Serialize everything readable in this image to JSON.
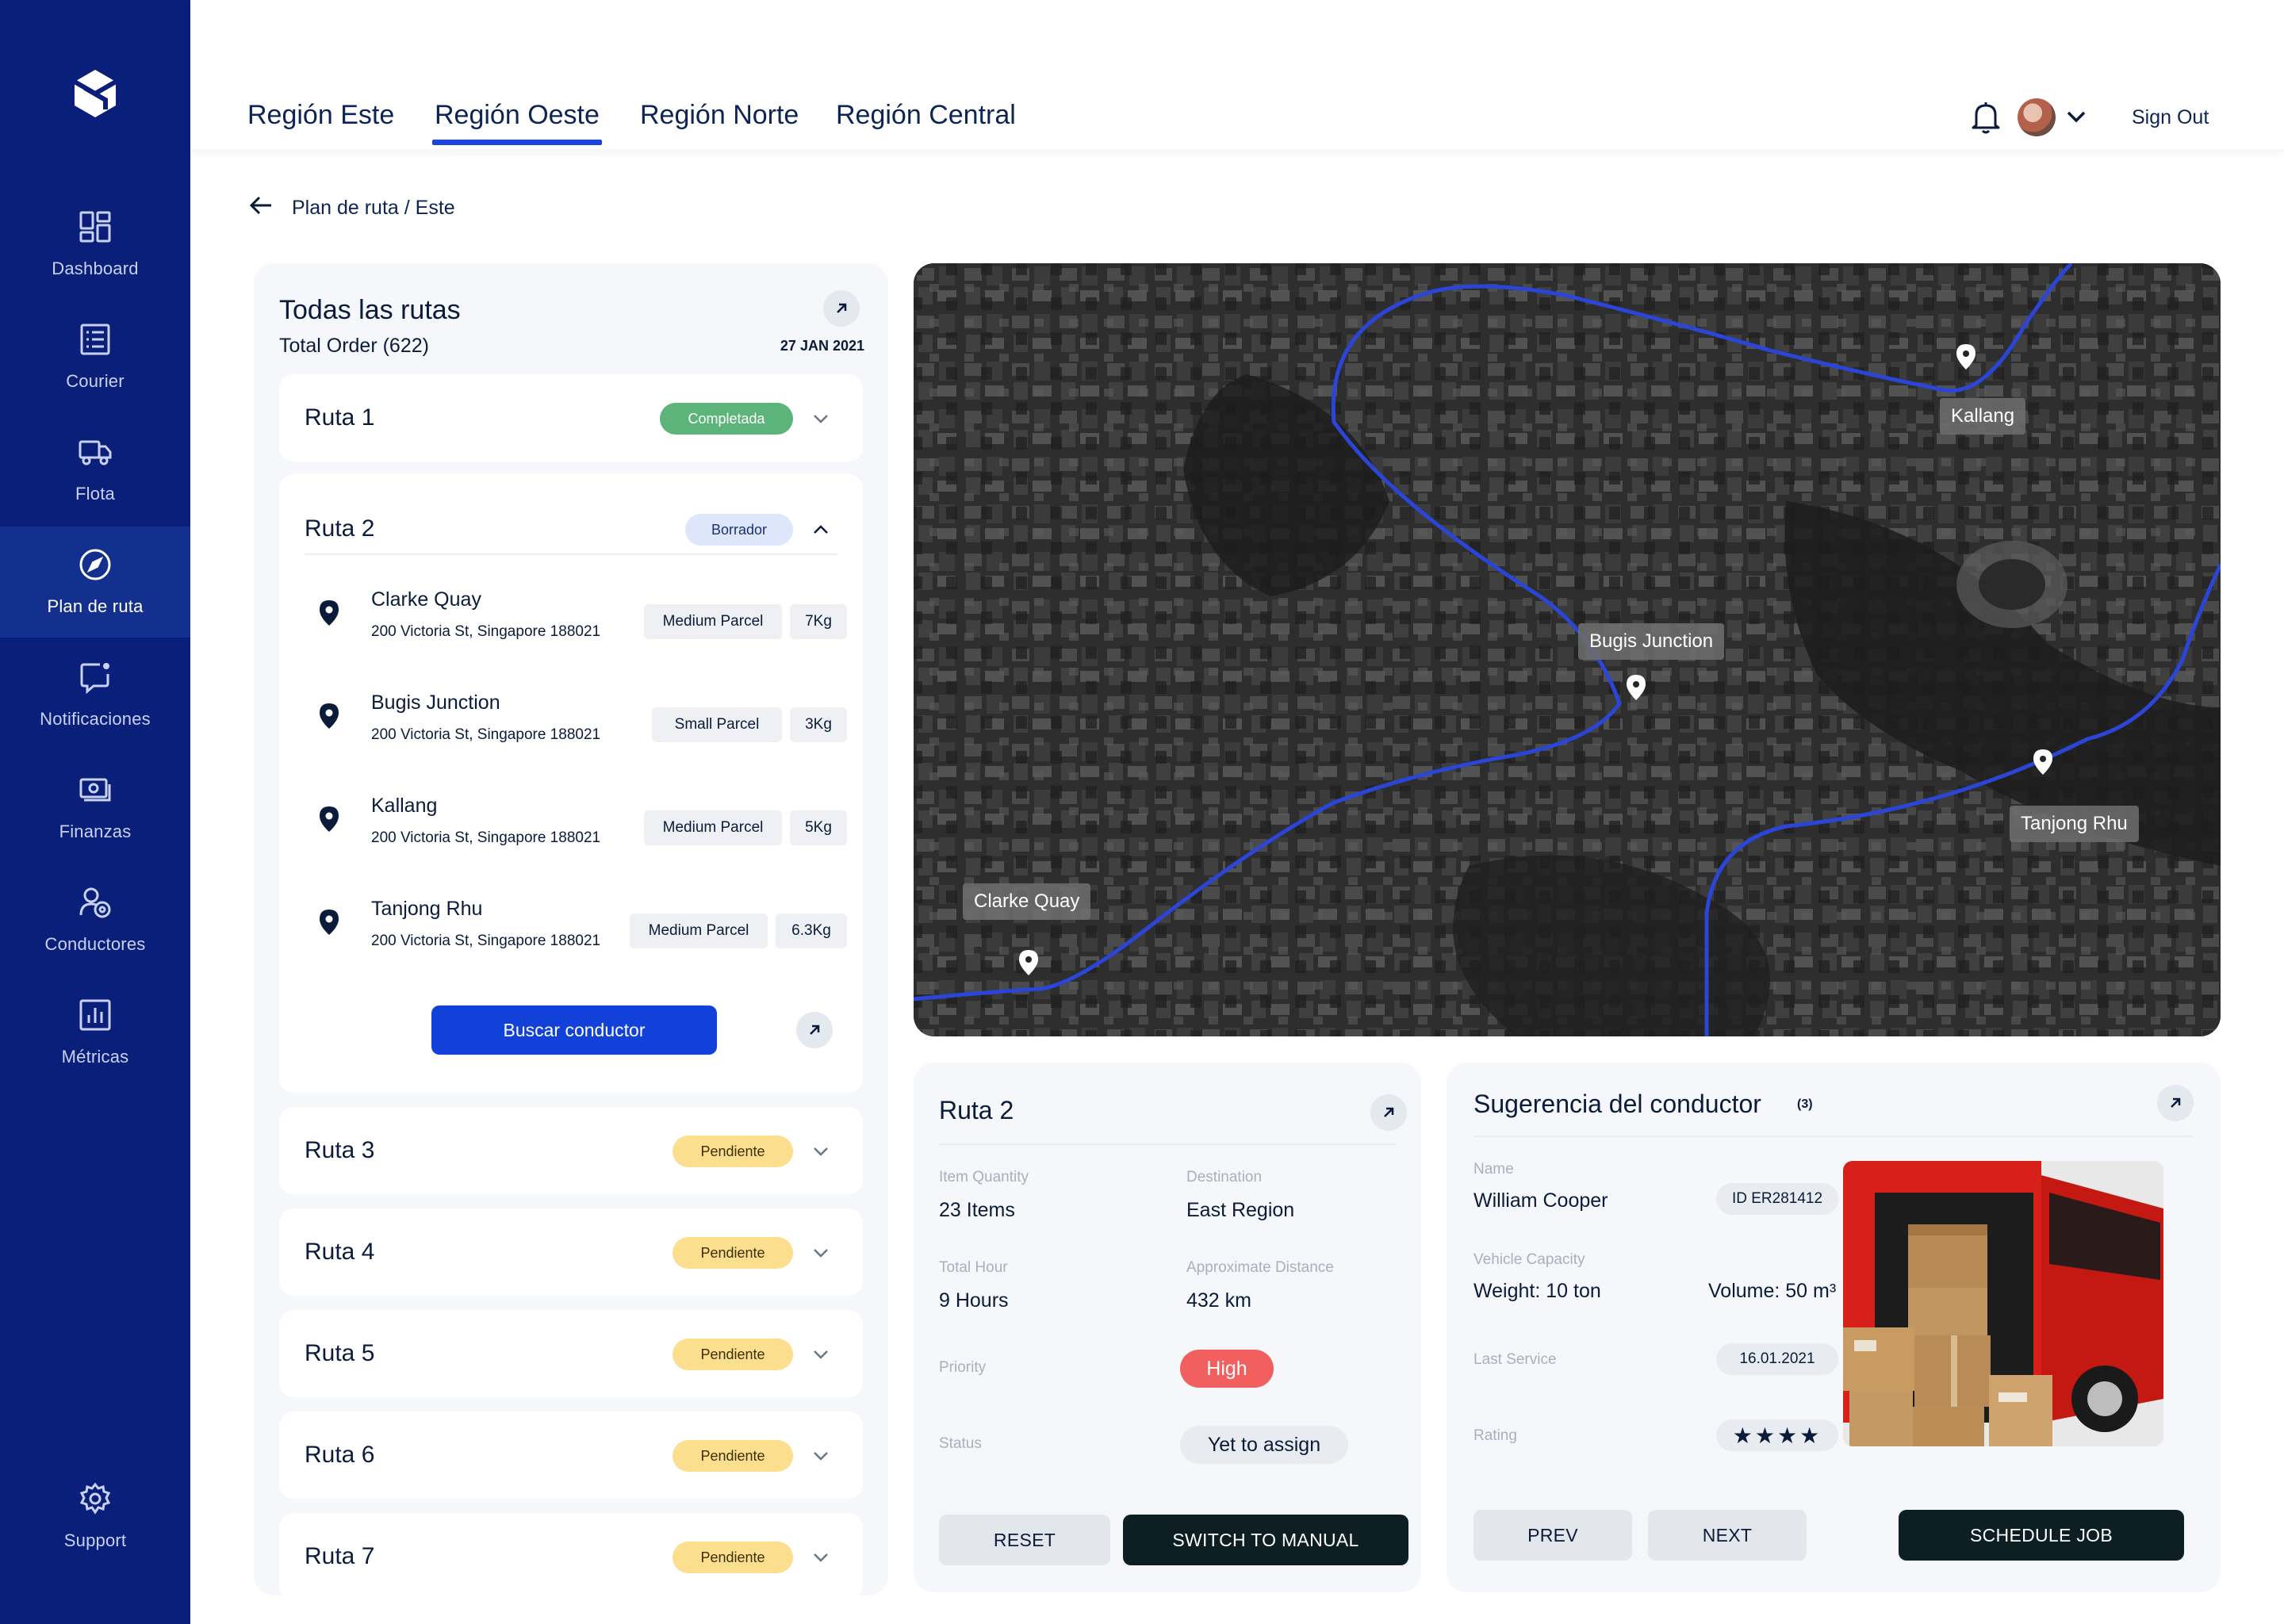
{
  "sidebar": {
    "items": [
      {
        "label": "Dashboard",
        "icon": "dashboard-icon"
      },
      {
        "label": "Courier",
        "icon": "courier-icon"
      },
      {
        "label": "Flota",
        "icon": "truck-icon"
      },
      {
        "label": "Plan de ruta",
        "icon": "compass-icon",
        "active": true
      },
      {
        "label": "Notificaciones",
        "icon": "notification-icon"
      },
      {
        "label": "Finanzas",
        "icon": "finance-icon"
      },
      {
        "label": "Conductores",
        "icon": "drivers-icon"
      },
      {
        "label": "Métricas",
        "icon": "metrics-icon"
      }
    ],
    "support_label": "Support"
  },
  "header": {
    "tabs": [
      {
        "label": "Región Este"
      },
      {
        "label": "Región Oeste",
        "active": true
      },
      {
        "label": "Región Norte"
      },
      {
        "label": "Región Central"
      }
    ],
    "signout_label": "Sign Out"
  },
  "breadcrumb": "Plan de ruta / Este",
  "routes": {
    "title": "Todas las rutas",
    "subtitle": "Total Order (622)",
    "date": "27 JAN 2021",
    "list": [
      {
        "name": "Ruta 1",
        "status": "Completada"
      },
      {
        "name": "Ruta 2",
        "status": "Borrador"
      },
      {
        "name": "Ruta 3",
        "status": "Pendiente"
      },
      {
        "name": "Ruta 4",
        "status": "Pendiente"
      },
      {
        "name": "Ruta 5",
        "status": "Pendiente"
      },
      {
        "name": "Ruta 6",
        "status": "Pendiente"
      },
      {
        "name": "Ruta 7",
        "status": "Pendiente"
      }
    ],
    "stops": [
      {
        "name": "Clarke Quay",
        "address": "200 Victoria St, Singapore 188021",
        "parcel": "Medium Parcel",
        "weight": "7Kg"
      },
      {
        "name": "Bugis Junction",
        "address": "200 Victoria St, Singapore 188021",
        "parcel": "Small Parcel",
        "weight": "3Kg"
      },
      {
        "name": "Kallang",
        "address": "200 Victoria St, Singapore 188021",
        "parcel": "Medium Parcel",
        "weight": "5Kg"
      },
      {
        "name": "Tanjong Rhu",
        "address": "200 Victoria St, Singapore 188021",
        "parcel": "Medium Parcel",
        "weight": "6.3Kg"
      }
    ],
    "find_driver_label": "Buscar conductor"
  },
  "map": {
    "labels": [
      "Kallang",
      "Bugis Junction",
      "Tanjong Rhu",
      "Clarke Quay"
    ],
    "route_color": "#2b46d6"
  },
  "details": {
    "title": "Ruta 2",
    "item_quantity_label": "Item Quantity",
    "item_quantity": "23 Items",
    "destination_label": "Destination",
    "destination": "East Region",
    "total_hour_label": "Total Hour",
    "total_hour": "9 Hours",
    "distance_label": "Approximate Distance",
    "distance": "432 km",
    "priority_label": "Priority",
    "priority": "High",
    "status_label": "Status",
    "status": "Yet to assign",
    "reset_label": "RESET",
    "switch_label": "SWITCH TO MANUAL"
  },
  "driver": {
    "title": "Sugerencia del conductor",
    "count": "(3)",
    "name_label": "Name",
    "name": "William Cooper",
    "id": "ID ER281412",
    "capacity_label": "Vehicle Capacity",
    "weight": "Weight: 10 ton",
    "volume": "Volume: 50 m³",
    "last_service_label": "Last Service",
    "last_service": "16.01.2021",
    "rating_label": "Rating",
    "rating": 4,
    "rating_stars": "★★★★",
    "prev_label": "PREV",
    "next_label": "NEXT",
    "schedule_label": "SCHEDULE JOB"
  },
  "colors": {
    "sidebar": "#0a1f7a",
    "accent": "#1141d8",
    "completed": "#5cb47a",
    "pending": "#fbdf8e",
    "draft": "#dde6fb",
    "priority_high": "#f15f5f"
  }
}
